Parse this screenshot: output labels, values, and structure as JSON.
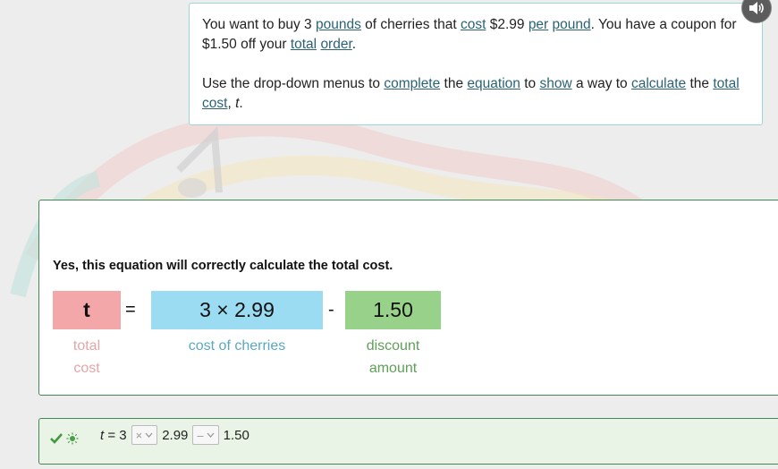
{
  "prompt": {
    "para1": [
      {
        "t": "You want to buy 3 "
      },
      {
        "t": "pounds",
        "link": true
      },
      {
        "t": " of cherries that "
      },
      {
        "t": "cost",
        "link": true
      },
      {
        "t": " $2.99 "
      },
      {
        "t": "per",
        "link": true
      },
      {
        "t": " "
      },
      {
        "t": "pound",
        "link": true
      },
      {
        "t": ". You have a coupon for $1.50 off your "
      },
      {
        "t": "total",
        "link": true
      },
      {
        "t": " "
      },
      {
        "t": "order",
        "link": true
      },
      {
        "t": "."
      }
    ],
    "para2": [
      {
        "t": "Use the drop-down menus to "
      },
      {
        "t": "complete",
        "link": true
      },
      {
        "t": " the "
      },
      {
        "t": "equation",
        "link": true
      },
      {
        "t": " to "
      },
      {
        "t": "show",
        "link": true
      },
      {
        "t": " a way to "
      },
      {
        "t": "calculate",
        "link": true
      },
      {
        "t": " the "
      },
      {
        "t": "total",
        "link": true
      },
      {
        "t": " "
      },
      {
        "t": "cost",
        "link": true
      },
      {
        "t": ", "
      },
      {
        "t": "t",
        "italic": true
      },
      {
        "t": "."
      }
    ]
  },
  "feedback": {
    "message": "Yes, this equation will correctly calculate the total cost.",
    "var_box": "t",
    "equals": "=",
    "cost_box": "3 × 2.99",
    "minus": "-",
    "discount_box": "1.50",
    "var_caption_1": "total",
    "var_caption_2": "cost",
    "cost_caption": "cost of cherries",
    "discount_caption_1": "discount",
    "discount_caption_2": "amount"
  },
  "answer": {
    "var": "t",
    "eq_prefix": " = 3",
    "op1_selected": "×",
    "val1": "2.99",
    "op2_selected": "–",
    "val2": "1.50"
  },
  "colors": {
    "var_box": "#f4a7a9",
    "cost_box": "#9bdcf2",
    "discount_box": "#98d28a",
    "panel_border": "#3f8a54",
    "link": "#2a6274"
  },
  "icons": [
    "speaker-icon",
    "checkmark-icon",
    "lightbulb-icon",
    "chevron-down-icon"
  ]
}
